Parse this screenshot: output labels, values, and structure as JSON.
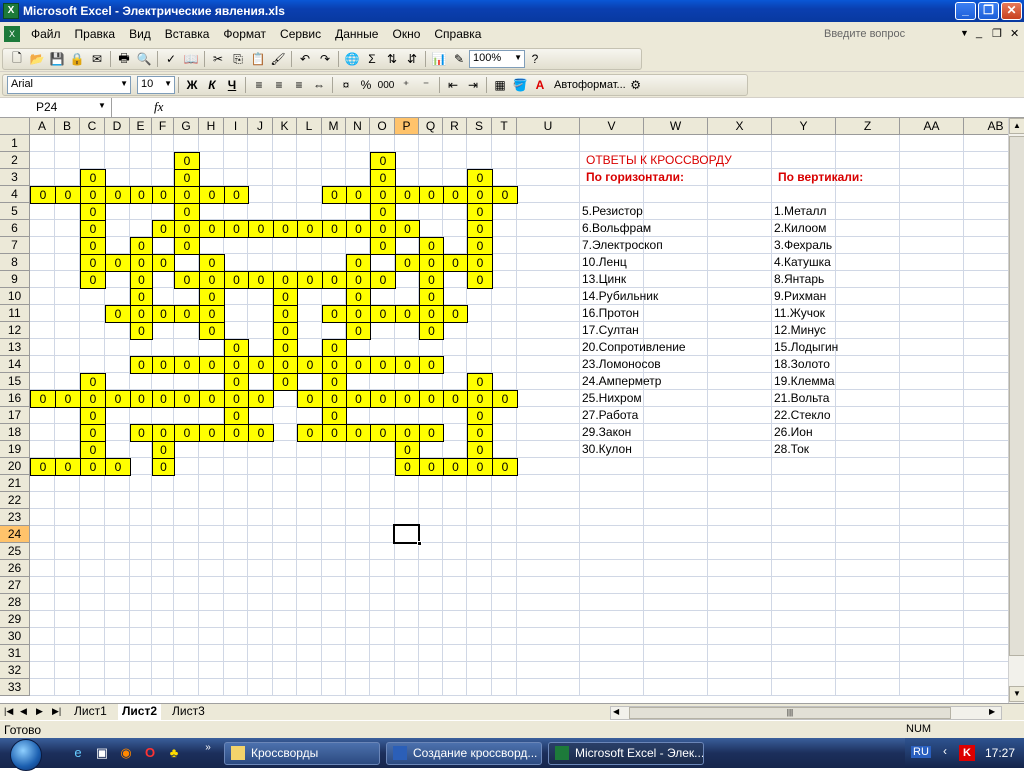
{
  "window": {
    "title": "Microsoft Excel - Электрические явления.xls",
    "app_icon": "excel-icon"
  },
  "menu": {
    "items": [
      "Файл",
      "Правка",
      "Вид",
      "Вставка",
      "Формат",
      "Сервис",
      "Данные",
      "Окно",
      "Справка"
    ],
    "help_placeholder": "Введите вопрос"
  },
  "toolbar": {
    "zoom": "100%",
    "font_name": "Arial",
    "font_size": "10",
    "bold": "Ж",
    "italic": "К",
    "underline": "Ч",
    "percent": "%",
    "thousands": "000",
    "autoformat": "Автоформат...",
    "sigma": "Σ"
  },
  "formula": {
    "namebox": "P24",
    "fx": "fx",
    "value": ""
  },
  "columns": [
    "A",
    "B",
    "C",
    "D",
    "E",
    "F",
    "G",
    "H",
    "I",
    "J",
    "K",
    "L",
    "M",
    "N",
    "O",
    "P",
    "Q",
    "R",
    "S",
    "T",
    "U",
    "V",
    "W",
    "X",
    "Y",
    "Z",
    "AA",
    "AB"
  ],
  "selected_col": "P",
  "selected_row": 24,
  "rows": [
    1,
    2,
    3,
    4,
    5,
    6,
    7,
    8,
    9,
    10,
    11,
    12,
    13,
    14,
    15,
    16,
    17,
    18,
    19,
    20,
    21,
    22,
    23,
    24,
    25,
    26,
    27,
    28,
    29,
    30,
    31,
    32,
    33
  ],
  "cell_value": "0",
  "crossword": {
    "2": [
      "G",
      "O"
    ],
    "3": [
      "C",
      "G",
      "O",
      "S"
    ],
    "4": [
      "A",
      "B",
      "C",
      "D",
      "E",
      "F",
      "G",
      "H",
      "I",
      "M",
      "N",
      "O",
      "P",
      "Q",
      "R",
      "S",
      "T"
    ],
    "5": [
      "C",
      "G",
      "O",
      "S"
    ],
    "6": [
      "C",
      "F",
      "G",
      "H",
      "I",
      "J",
      "K",
      "L",
      "M",
      "N",
      "O",
      "P",
      "S"
    ],
    "7": [
      "C",
      "E",
      "G",
      "O",
      "Q",
      "S"
    ],
    "8": [
      "C",
      "D",
      "E",
      "F",
      "H",
      "N",
      "P",
      "Q",
      "R",
      "S"
    ],
    "9": [
      "C",
      "E",
      "G",
      "H",
      "I",
      "J",
      "K",
      "L",
      "M",
      "N",
      "O",
      "Q",
      "S"
    ],
    "10": [
      "E",
      "H",
      "K",
      "N",
      "Q"
    ],
    "11": [
      "D",
      "E",
      "F",
      "G",
      "H",
      "K",
      "M",
      "N",
      "O",
      "P",
      "Q",
      "R"
    ],
    "12": [
      "E",
      "H",
      "K",
      "N",
      "Q"
    ],
    "13": [
      "I",
      "K",
      "M"
    ],
    "14": [
      "E",
      "F",
      "G",
      "H",
      "I",
      "J",
      "K",
      "L",
      "M",
      "N",
      "O",
      "P",
      "Q"
    ],
    "15": [
      "C",
      "I",
      "K",
      "M",
      "S"
    ],
    "16": [
      "A",
      "B",
      "C",
      "D",
      "E",
      "F",
      "G",
      "H",
      "I",
      "J",
      "L",
      "M",
      "N",
      "O",
      "P",
      "Q",
      "R",
      "S",
      "T"
    ],
    "17": [
      "C",
      "I",
      "M",
      "S"
    ],
    "18": [
      "C",
      "E",
      "F",
      "G",
      "H",
      "I",
      "J",
      "L",
      "M",
      "N",
      "O",
      "P",
      "Q",
      "S"
    ],
    "19": [
      "C",
      "F",
      "P",
      "S"
    ],
    "20": [
      "A",
      "B",
      "C",
      "D",
      "F",
      "P",
      "Q",
      "R",
      "S",
      "T"
    ]
  },
  "answers": {
    "title": "ОТВЕТЫ К КРОССВОРДУ",
    "horizontal_header": "По горизонтали:",
    "vertical_header": "По вертикали:",
    "horizontal": [
      "5.Резистор",
      "6.Вольфрам",
      "7.Электроскоп",
      "10.Ленц",
      "13.Цинк",
      "14.Рубильник",
      "16.Протон",
      "17.Султан",
      "20.Сопротивление",
      "23.Ломоносов",
      "24.Амперметр",
      "25.Нихром",
      "27.Работа",
      "29.Закон",
      "30.Кулон"
    ],
    "vertical": [
      "1.Металл",
      "2.Килоом",
      "3.Фехраль",
      "4.Катушка",
      "8.Янтарь",
      "9.Рихман",
      "11.Жучок",
      "12.Минус",
      "15.Лодыгин",
      "18.Золото",
      "19.Клемма",
      "21.Вольта",
      "22.Стекло",
      "26.Ион",
      "28.Ток"
    ]
  },
  "sheets": [
    "Лист1",
    "Лист2",
    "Лист3"
  ],
  "active_sheet": "Лист2",
  "status": {
    "left": "Готово",
    "num": "NUM"
  },
  "taskbar": {
    "items": [
      "Кроссворды",
      "Создание кроссворд...",
      "Microsoft Excel - Элек..."
    ],
    "lang": "RU",
    "time": "17:27"
  },
  "colors": {
    "crossword_fill": "#ffff00",
    "answer_title": "#d80000",
    "selection_header": "#ffc36b"
  }
}
